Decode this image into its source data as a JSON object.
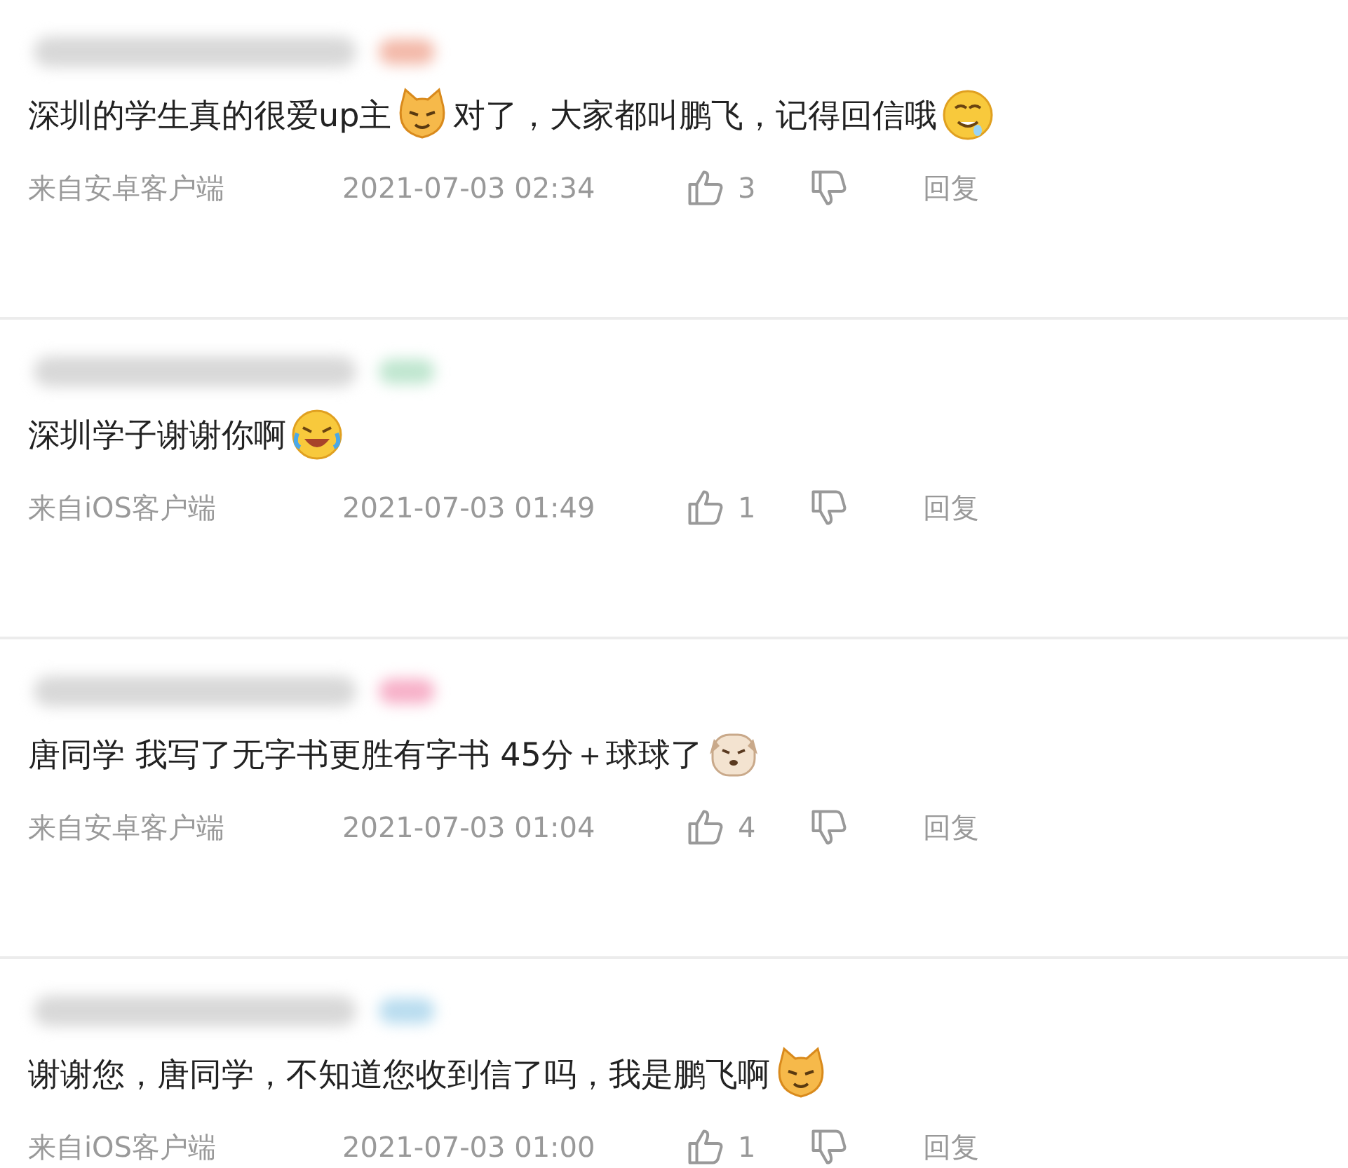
{
  "comments": [
    {
      "body": [
        {
          "kind": "text",
          "text": "深圳的学生真的很爱up主"
        },
        {
          "kind": "cat"
        },
        {
          "kind": "text",
          "text": "对了，大家都叫鹏飞，记得回信哦"
        },
        {
          "kind": "drool"
        }
      ],
      "source": "来自安卓客户端",
      "time": "2021-07-03 02:34",
      "likes": "3",
      "reply": "回复"
    },
    {
      "body": [
        {
          "kind": "text",
          "text": "深圳学子谢谢你啊"
        },
        {
          "kind": "laughcry"
        }
      ],
      "source": "来自iOS客户端",
      "time": "2021-07-03 01:49",
      "likes": "1",
      "reply": "回复"
    },
    {
      "body": [
        {
          "kind": "text",
          "text": "唐同学 我写了无字书更胜有字书 45分＋球球了"
        },
        {
          "kind": "dog"
        }
      ],
      "source": "来自安卓客户端",
      "time": "2021-07-03 01:04",
      "likes": "4",
      "reply": "回复"
    },
    {
      "body": [
        {
          "kind": "text",
          "text": "谢谢您，唐同学，不知道您收到信了吗，我是鹏飞啊"
        },
        {
          "kind": "cat"
        }
      ],
      "source": "来自iOS客户端",
      "time": "2021-07-03 01:00",
      "likes": "1",
      "reply": "回复"
    }
  ]
}
